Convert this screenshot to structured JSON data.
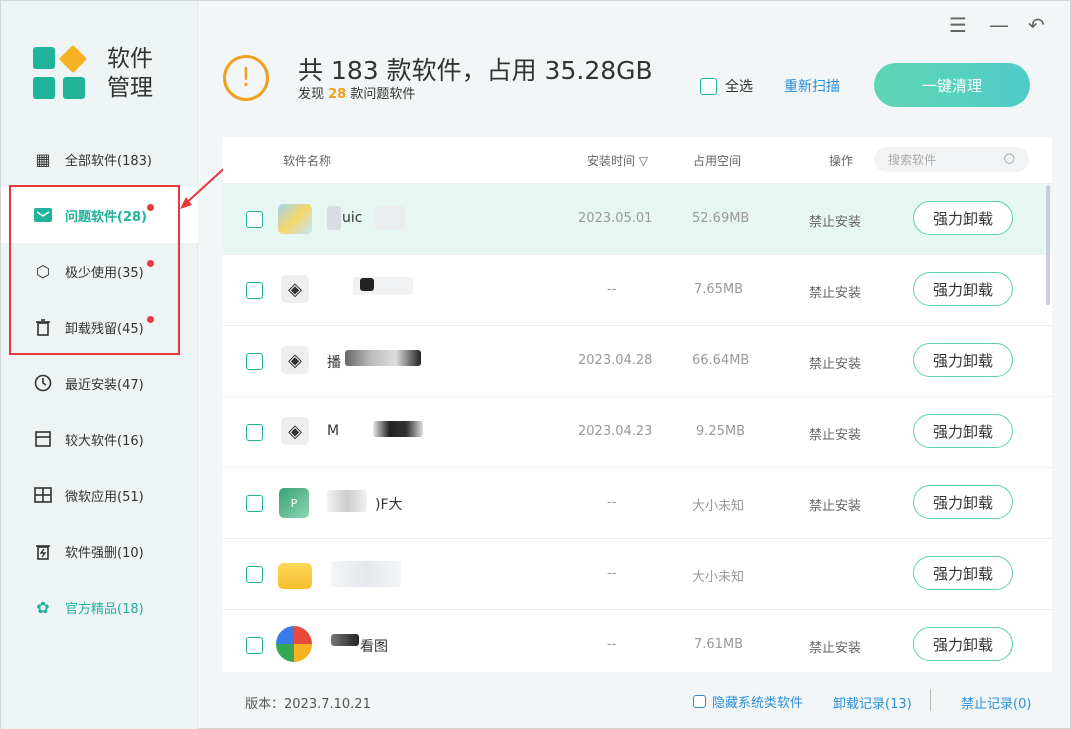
{
  "window_controls": {
    "menu": "☰",
    "minimize": "—",
    "back": "↶"
  },
  "logo": {
    "line1": "软件",
    "line2": "管理",
    "colors": [
      "#1fb39a",
      "#f5b323",
      "#1fb39a",
      "#1fb39a"
    ]
  },
  "sidebar": {
    "items": [
      {
        "label": "全部软件(183)",
        "icon": "grid-icon",
        "badge": false
      },
      {
        "label": "问题软件(28)",
        "icon": "mail-icon",
        "badge": true,
        "active": true
      },
      {
        "label": "极少使用(35)",
        "icon": "hexagon-icon",
        "badge": true
      },
      {
        "label": "卸载残留(45)",
        "icon": "trash-icon",
        "badge": true
      },
      {
        "label": "最近安装(47)",
        "icon": "clock-icon",
        "badge": false
      },
      {
        "label": "较大软件(16)",
        "icon": "box-icon",
        "badge": false
      },
      {
        "label": "微软应用(51)",
        "icon": "windows-icon",
        "badge": false
      },
      {
        "label": "软件强删(10)",
        "icon": "trash-force-icon",
        "badge": false
      },
      {
        "label": "官方精品(18)",
        "icon": "flower-icon",
        "badge": false,
        "green": true
      }
    ]
  },
  "header": {
    "headline": "共 183 款软件，占用 35.28GB",
    "sub_prefix": "发现 ",
    "sub_count": "28",
    "sub_suffix": " 款问题软件",
    "select_all": "全选",
    "rescan": "重新扫描",
    "clean": "一键清理"
  },
  "table": {
    "headers": {
      "name": "软件名称",
      "install_time": "安装时间 ▽",
      "size": "占用空间",
      "action": "操作"
    },
    "search_placeholder": "搜索软件",
    "rows": [
      {
        "name": "uic",
        "time": "2023.05.01",
        "size": "52.69MB",
        "status": "禁止安装",
        "btn": "强力卸载"
      },
      {
        "name": "",
        "time": "--",
        "size": "7.65MB",
        "status": "禁止安装",
        "btn": "强力卸载"
      },
      {
        "name": "播",
        "time": "2023.04.28",
        "size": "66.64MB",
        "status": "禁止安装",
        "btn": "强力卸载"
      },
      {
        "name": "M",
        "time": "2023.04.23",
        "size": "9.25MB",
        "status": "禁止安装",
        "btn": "强力卸载"
      },
      {
        "name": ")F大",
        "time": "--",
        "size": "大小未知",
        "status": "禁止安装",
        "btn": "强力卸载"
      },
      {
        "name": "",
        "time": "--",
        "size": "大小未知",
        "status": "",
        "btn": "强力卸载"
      },
      {
        "name": "看图",
        "time": "--",
        "size": "7.61MB",
        "status": "禁止安装",
        "btn": "强力卸载"
      }
    ]
  },
  "footer": {
    "version": "版本：2023.7.10.21",
    "hide_system": "隐藏系统类软件",
    "uninstall_log": "卸载记录(13)",
    "ban_log": "禁止记录(0)"
  }
}
